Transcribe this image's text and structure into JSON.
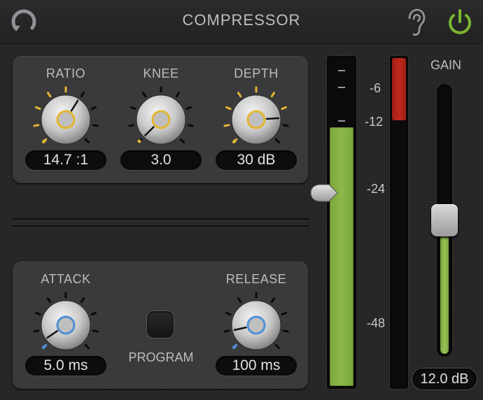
{
  "header": {
    "title": "COMPRESSOR",
    "icons": {
      "reset": "reset-icon",
      "listen": "ear-icon",
      "power": "power-icon"
    },
    "power_color": "#7ab833"
  },
  "knobs_top": [
    {
      "id": "ratio",
      "label": "RATIO",
      "value": "14.7 :1",
      "accent": "#e3b530",
      "level": 0.62
    },
    {
      "id": "knee",
      "label": "KNEE",
      "value": "3.0",
      "accent": "#e3b530",
      "level": 0.0
    },
    {
      "id": "depth",
      "label": "DEPTH",
      "value": "30 dB",
      "accent": "#e3b530",
      "level": 0.82
    }
  ],
  "knobs_bottom": [
    {
      "id": "attack",
      "label": "ATTACK",
      "value": "5.0 ms",
      "accent": "#4f8fd6",
      "level": 0.04
    },
    {
      "id": "release",
      "label": "RELEASE",
      "value": "100 ms",
      "accent": "#4f8fd6",
      "level": 0.12
    }
  ],
  "program": {
    "label": "PROGRAM",
    "active": false
  },
  "meter": {
    "scale": [
      "-6",
      "-12",
      "-24",
      "-48"
    ],
    "threshold_level": 0.59,
    "input_level": 0.79,
    "gain_reduction_level": 0.19,
    "input_color": "#8cb84a",
    "reduction_color": "#c0281d"
  },
  "gain": {
    "label": "GAIN",
    "value": "12.0 dB",
    "level": 0.5
  }
}
